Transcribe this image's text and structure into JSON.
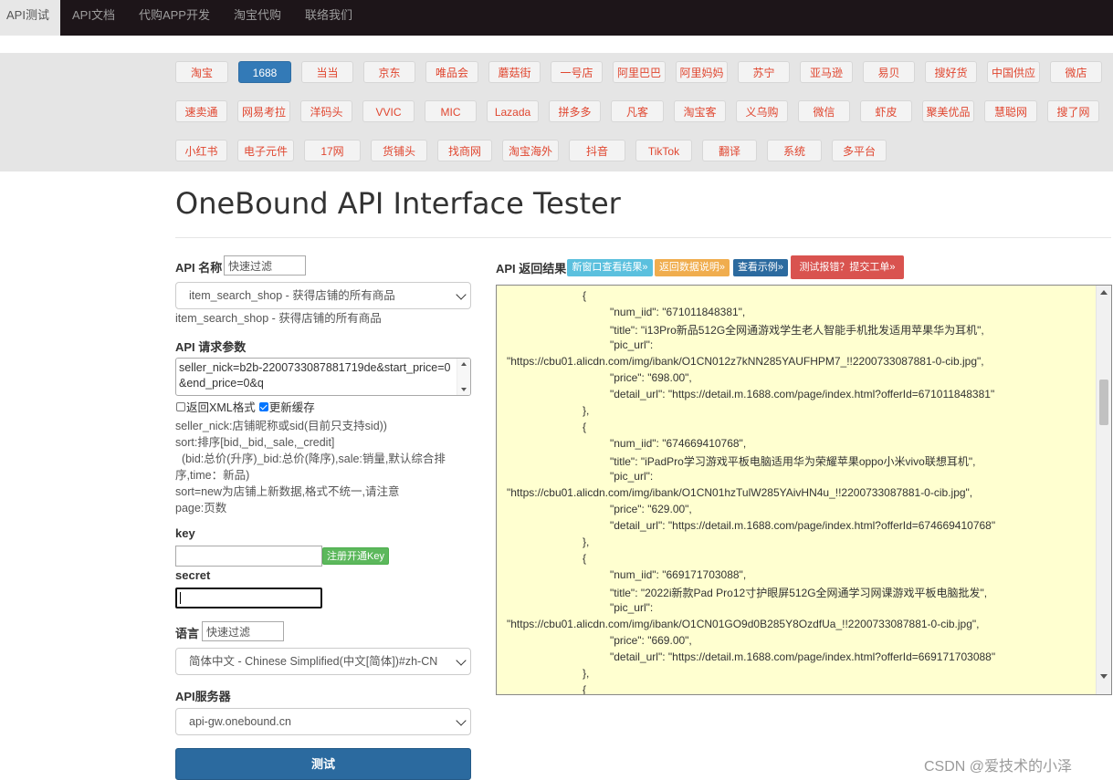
{
  "nav": {
    "items": [
      "API测试",
      "API文档",
      "代购APP开发",
      "淘宝代购",
      "联络我们"
    ],
    "active": 0
  },
  "platforms": {
    "rows": [
      [
        "淘宝",
        "1688",
        "当当",
        "京东",
        "唯品会",
        "蘑菇街",
        "一号店",
        "阿里巴巴",
        "阿里妈妈",
        "苏宁",
        "亚马逊",
        "易贝",
        "搜好货",
        "中国供应",
        "微店"
      ],
      [
        "速卖通",
        "网易考拉",
        "洋码头",
        "VVIC",
        "MIC",
        "Lazada",
        "拼多多",
        "凡客",
        "淘宝客",
        "义乌购",
        "微信",
        "虾皮",
        "聚美优品",
        "慧聪网",
        "搜了网"
      ],
      [
        "小红书",
        "电子元件",
        "17网",
        "货铺头",
        "找商网",
        "淘宝海外",
        "抖音",
        "TikTok",
        "翻译",
        "系统",
        "多平台"
      ]
    ],
    "active": "1688"
  },
  "page": {
    "title": "OneBound API Interface Tester"
  },
  "form": {
    "api_name_label": "API 名称",
    "api_filter_placeholder": "快速过滤",
    "api_selected": "item_search_shop - 获得店铺的所有商品",
    "api_selected_text": "item_search_shop - 获得店铺的所有商品",
    "params_label": "API 请求参数",
    "params_value": "seller_nick=b2b-2200733087881719de&start_price=0&end_price=0&q",
    "xml_label": "返回XML格式",
    "xml_checked": false,
    "cache_label": "更新缓存",
    "cache_checked": true,
    "description": [
      "seller_nick:店铺昵称或sid(目前只支持sid))",
      "sort:排序[bid,_bid,_sale,_credit]",
      "  (bid:总价(升序)_bid:总价(降序),sale:销量,默认综合排",
      "序,time：新品)",
      "sort=new为店铺上新数据,格式不统一,请注意",
      "page:页数"
    ],
    "key_label": "key",
    "register_label": "注册开通Key",
    "secret_label": "secret",
    "lang_label": "语言",
    "lang_filter_placeholder": "快速过滤",
    "lang_selected": "简体中文 - Chinese Simplified(中文[简体])#zh-CN",
    "server_label": "API服务器",
    "server_selected": "api-gw.onebound.cn",
    "test_label": "测试"
  },
  "result": {
    "label": "API 返回结果",
    "buttons": [
      {
        "label": "新窗口查看结果»",
        "color": "#5bc0de"
      },
      {
        "label": "返回数据说明»",
        "color": "#f0ad4e"
      },
      {
        "label": "查看示例»",
        "color": "#2b6a9f"
      },
      {
        "label": "测试报错？提交工单»",
        "color": "#d9534f"
      }
    ],
    "lines": [
      "{",
      "\"num_iid\": \"671011848381\",",
      "\"title\": \"i13Pro新品512G全网通游戏学生老人智能手机批发适用苹果华为耳机\",",
      "\"pic_url\":",
      "\"https://cbu01.alicdn.com/img/ibank/O1CN012z7kNN285YAUFHPM7_!!2200733087881-0-cib.jpg\",",
      "\"price\": \"698.00\",",
      "\"detail_url\": \"https://detail.m.1688.com/page/index.html?offerId=671011848381\"",
      "},",
      "{",
      "\"num_iid\": \"674669410768\",",
      "\"title\": \"iPadPro学习游戏平板电脑适用华为荣耀苹果oppo小米vivo联想耳机\",",
      "\"pic_url\":",
      "\"https://cbu01.alicdn.com/img/ibank/O1CN01hzTulW285YAivHN4u_!!2200733087881-0-cib.jpg\",",
      "\"price\": \"629.00\",",
      "\"detail_url\": \"https://detail.m.1688.com/page/index.html?offerId=674669410768\"",
      "},",
      "{",
      "\"num_iid\": \"669171703088\",",
      "\"title\": \"2022i新款Pad Pro12寸护眼屏512G全网通学习网课游戏平板电脑批发\",",
      "\"pic_url\":",
      "\"https://cbu01.alicdn.com/img/ibank/O1CN01GO9d0B285Y8OzdfUa_!!2200733087881-0-cib.jpg\",",
      "\"price\": \"669.00\",",
      "\"detail_url\": \"https://detail.m.1688.com/page/index.html?offerId=669171703088\"",
      "},",
      "{"
    ]
  },
  "watermark": "CSDN @爱技术的小泽"
}
